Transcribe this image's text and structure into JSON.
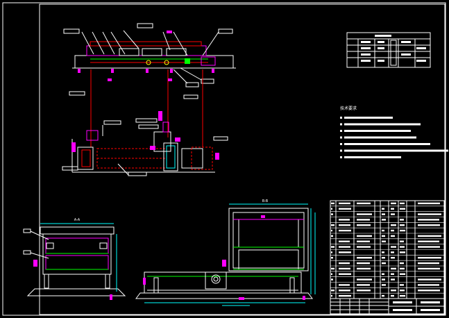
{
  "drawing": {
    "background": "#000000",
    "frame_color": "#ffffff",
    "colors": {
      "white": "#ffffff",
      "magenta": "#ff00ff",
      "red": "#ff0000",
      "cyan": "#00ffff",
      "green": "#00ff00",
      "yellow": "#ffff00",
      "blue": "#4040ff"
    }
  },
  "views": {
    "top_view_label": "",
    "section_left_label": "A-A",
    "section_right_label": "B-B"
  },
  "notes": {
    "title": "技术要求",
    "count": 7
  },
  "bom": {
    "rows": 18
  },
  "title_block": {
    "rows": 4
  }
}
